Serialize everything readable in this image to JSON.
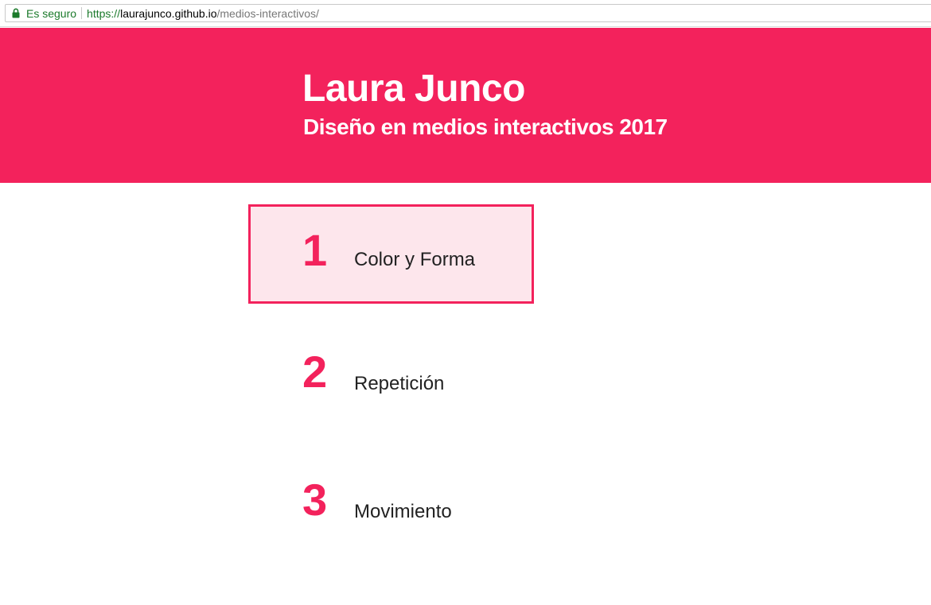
{
  "browser": {
    "secure_label": "Es seguro",
    "url_scheme": "https://",
    "url_host": "laurajunco.github.io",
    "url_path": "/medios-interactivos/",
    "secure_color": "#1b7a2b"
  },
  "header": {
    "title": "Laura Junco",
    "subtitle": "Diseño en medios interactivos 2017",
    "background_color": "#f3225c"
  },
  "menu": {
    "items": [
      {
        "number": "1",
        "label": "Color y Forma",
        "active": true
      },
      {
        "number": "2",
        "label": "Repetición",
        "active": false
      },
      {
        "number": "3",
        "label": "Movimiento",
        "active": false
      }
    ],
    "accent_color": "#f3225c",
    "active_background": "#fde6ec"
  }
}
